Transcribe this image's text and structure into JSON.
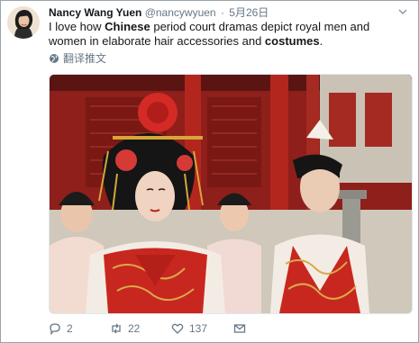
{
  "tweet": {
    "author_name": "Nancy Wang Yuen",
    "handle": "@nancywyuen",
    "separator": "·",
    "date": "5月26日",
    "text_parts": [
      {
        "text": "I love how ",
        "bold": false
      },
      {
        "text": "Chinese",
        "bold": true
      },
      {
        "text": " period court dramas depict royal men and women in elaborate hair accessories and ",
        "bold": false
      },
      {
        "text": "costumes",
        "bold": true
      },
      {
        "text": ".",
        "bold": false
      }
    ],
    "translate_label": "翻译推文"
  },
  "actions": {
    "reply_count": "2",
    "retweet_count": "22",
    "like_count": "137"
  },
  "icons": {
    "reply": "reply-icon",
    "retweet": "retweet-icon",
    "like": "heart-icon",
    "share": "mail-icon",
    "translate": "globe-icon",
    "more": "chevron-down-icon"
  },
  "colors": {
    "text_primary": "#14171a",
    "text_secondary": "#657786",
    "palace_red": "#b3261e",
    "background": "#ffffff"
  }
}
